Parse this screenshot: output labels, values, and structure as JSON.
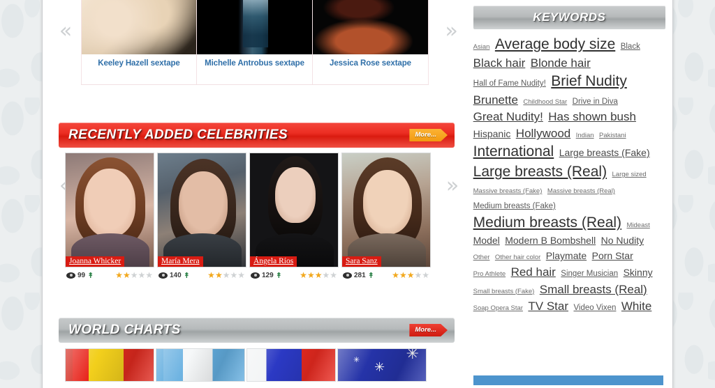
{
  "videos": {
    "prev_icon": "chevron-double-left-icon",
    "next_icon": "chevron-double-right-icon",
    "items": [
      {
        "caption": "Keeley Hazell sextape"
      },
      {
        "caption": "Michelle Antrobus sextape"
      },
      {
        "caption": "Jessica Rose sextape"
      }
    ]
  },
  "recently_added": {
    "title": "RECENTLY ADDED CELEBRITIES",
    "more_label": "More...",
    "prev_icon": "chevron-double-left-icon",
    "next_icon": "chevron-double-right-icon",
    "celebs": [
      {
        "name": "Joanna Whicker",
        "views": "99",
        "rating": 2,
        "trend_icon": "arrow-up-icon",
        "views_icon": "eye-icon"
      },
      {
        "name": "María Mera",
        "views": "140",
        "rating": 2,
        "trend_icon": "arrow-up-icon",
        "views_icon": "eye-icon"
      },
      {
        "name": "Ángela Ríos",
        "views": "129",
        "rating": 3,
        "trend_icon": "arrow-up-icon",
        "views_icon": "eye-icon"
      },
      {
        "name": "Sara Sanz",
        "views": "281",
        "rating": 3,
        "trend_icon": "arrow-up-icon",
        "views_icon": "eye-icon"
      }
    ]
  },
  "world_charts": {
    "title": "WORLD CHARTS",
    "more_label": "More...",
    "flags": [
      {
        "name": "romania-flag"
      },
      {
        "name": "argentina-flag"
      },
      {
        "name": "france-flag"
      },
      {
        "name": "australia-flag"
      }
    ]
  },
  "sidebar": {
    "keywords_title": "KEYWORDS",
    "keywords": [
      {
        "label": "Asian",
        "size": 1
      },
      {
        "label": "Average body size",
        "size": 5
      },
      {
        "label": "Black",
        "size": 2
      },
      {
        "label": "Black hair",
        "size": 4
      },
      {
        "label": "Blonde hair",
        "size": 4
      },
      {
        "label": "Hall of Fame Nudity!",
        "size": 2
      },
      {
        "label": "Brief Nudity",
        "size": 5
      },
      {
        "label": "Brunette",
        "size": 4
      },
      {
        "label": "Childhood Star",
        "size": 1
      },
      {
        "label": "Drive in Diva",
        "size": 2
      },
      {
        "label": "Great Nudity!",
        "size": 4
      },
      {
        "label": "Has shown bush",
        "size": 4
      },
      {
        "label": "Hispanic",
        "size": 3
      },
      {
        "label": "Hollywood",
        "size": 4
      },
      {
        "label": "Indian",
        "size": 1
      },
      {
        "label": "Pakistani",
        "size": 1
      },
      {
        "label": "International",
        "size": 5
      },
      {
        "label": "Large breasts (Fake)",
        "size": 3
      },
      {
        "label": "Large breasts (Real)",
        "size": 5
      },
      {
        "label": "Large sized",
        "size": 1
      },
      {
        "label": "Massive breasts (Fake)",
        "size": 1
      },
      {
        "label": "Massive breasts (Real)",
        "size": 1
      },
      {
        "label": "Medium breasts (Fake)",
        "size": 2
      },
      {
        "label": "Medium breasts (Real)",
        "size": 5
      },
      {
        "label": "Mideast",
        "size": 1
      },
      {
        "label": "Model",
        "size": 3
      },
      {
        "label": "Modern B Bombshell",
        "size": 3
      },
      {
        "label": "No Nudity",
        "size": 3
      },
      {
        "label": "Other",
        "size": 1
      },
      {
        "label": "Other hair color",
        "size": 1
      },
      {
        "label": "Playmate",
        "size": 3
      },
      {
        "label": "Porn Star",
        "size": 3
      },
      {
        "label": "Pro Athlete",
        "size": 1
      },
      {
        "label": "Red hair",
        "size": 4
      },
      {
        "label": "Singer Musician",
        "size": 2
      },
      {
        "label": "Skinny",
        "size": 3
      },
      {
        "label": "Small breasts (Fake)",
        "size": 1
      },
      {
        "label": "Small breasts (Real)",
        "size": 4
      },
      {
        "label": "Soap Opera Star",
        "size": 1
      },
      {
        "label": "TV Star",
        "size": 4
      },
      {
        "label": "Video Vixen",
        "size": 2
      },
      {
        "label": "White",
        "size": 4
      }
    ]
  },
  "colors": {
    "accent_red": "#d91b10",
    "accent_orange": "#f29a11",
    "link_blue": "#2f6fa8",
    "star_gold": "#f2a81d",
    "blue_bar": "#4d94cd"
  }
}
